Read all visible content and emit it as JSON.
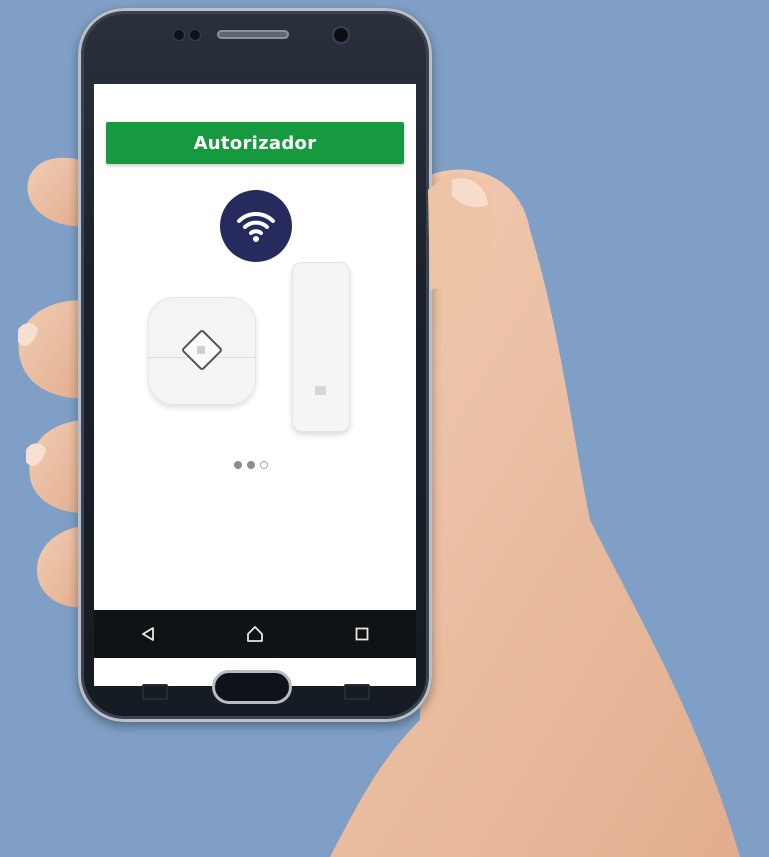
{
  "app": {
    "title": "Autorizador",
    "accent_color": "#179a3f",
    "icon_bg_color": "#262a5c",
    "background_color": "#7f9fc6"
  },
  "hero": {
    "icon": "wifi-icon",
    "devices": [
      "sensor-hub-device",
      "door-sensor-device"
    ]
  },
  "pager": {
    "total": 3,
    "current": 3
  },
  "navbar": {
    "buttons": [
      "back-icon",
      "home-icon",
      "recents-icon"
    ]
  }
}
